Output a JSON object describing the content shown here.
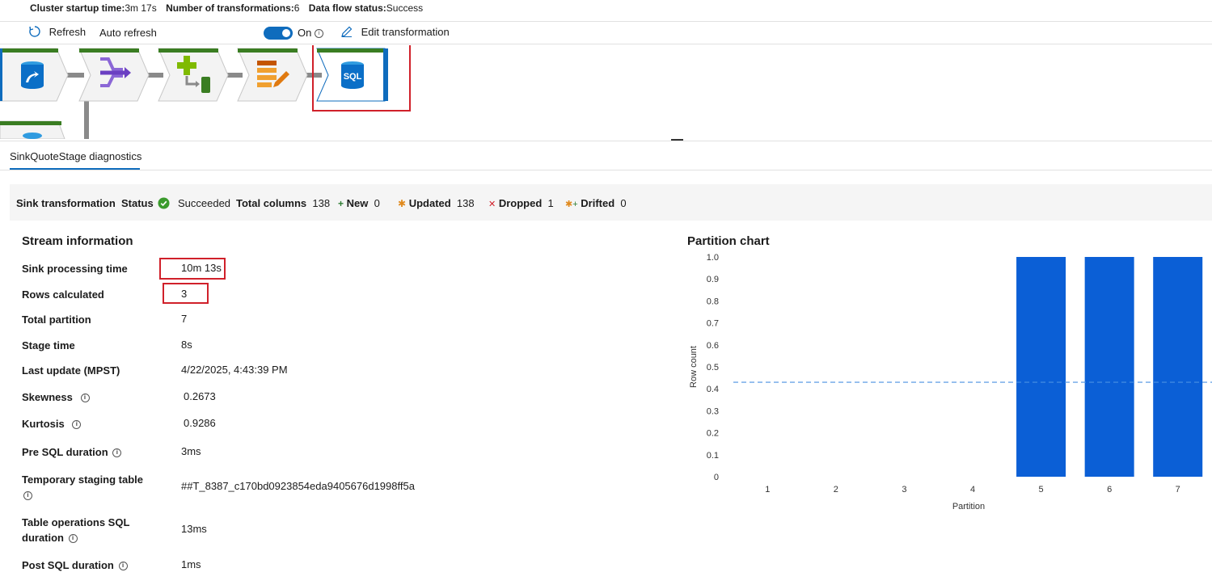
{
  "header": {
    "cluster_startup_label": "Cluster startup time:",
    "cluster_startup_value": "3m 17s",
    "transformations_label": "Number of transformations:",
    "transformations_value": "6",
    "status_label": "Data flow status:",
    "status_value": "Success"
  },
  "toolbar": {
    "refresh_label": "Refresh",
    "auto_refresh_label": "Auto refresh",
    "toggle_label": "On",
    "edit_label": "Edit transformation"
  },
  "pipeline": {
    "accent_color": "#3a7d22",
    "nodes": [
      "source-icon",
      "join-icon",
      "derived-column-icon",
      "alter-row-icon",
      "sql-sink-icon"
    ],
    "sink_node_text": "SQL"
  },
  "tab": {
    "label": "SinkQuoteStage diagnostics"
  },
  "summary": {
    "transformation_label": "Sink transformation",
    "status_label": "Status",
    "status_value": "Succeeded",
    "total_columns_label": "Total columns",
    "total_columns_value": "138",
    "new_label": "New",
    "new_value": "0",
    "updated_label": "Updated",
    "updated_value": "138",
    "dropped_label": "Dropped",
    "dropped_value": "1",
    "drifted_label": "Drifted",
    "drifted_value": "0"
  },
  "stream": {
    "title": "Stream information",
    "rows": [
      {
        "label": "Sink processing time",
        "value": "10m 13s"
      },
      {
        "label": "Rows calculated",
        "value": "3"
      },
      {
        "label": "Total partition",
        "value": "7"
      },
      {
        "label": "Stage time",
        "value": "8s"
      },
      {
        "label": "Last update (MPST)",
        "value": "4/22/2025, 4:43:39 PM"
      },
      {
        "label": "Skewness",
        "value": "0.2673"
      },
      {
        "label": "Kurtosis",
        "value": "0.9286"
      },
      {
        "label": "Pre SQL duration",
        "value": "3ms"
      },
      {
        "label": "Temporary staging table",
        "value": "##T_8387_c170bd0923854eda9405676d1998ff5a"
      },
      {
        "label": "Table operations SQL duration",
        "value": "13ms"
      },
      {
        "label": "Post SQL duration",
        "value": "1ms"
      }
    ]
  },
  "partition_chart": {
    "title": "Partition chart",
    "bar_color": "#0b5fd6",
    "avg_line_color": "#4a90e2"
  },
  "chart_data": {
    "type": "bar",
    "title": "Partition chart",
    "xlabel": "Partition",
    "ylabel": "Row count",
    "categories": [
      "1",
      "2",
      "3",
      "4",
      "5",
      "6",
      "7"
    ],
    "values": [
      0,
      0,
      0,
      0,
      1,
      1,
      1
    ],
    "average": 0.43,
    "ylim": [
      0,
      1.0
    ],
    "yticks": [
      "0",
      "0.1",
      "0.2",
      "0.3",
      "0.4",
      "0.5",
      "0.6",
      "0.7",
      "0.8",
      "0.9",
      "1.0"
    ],
    "grid": false,
    "legend": "none"
  }
}
